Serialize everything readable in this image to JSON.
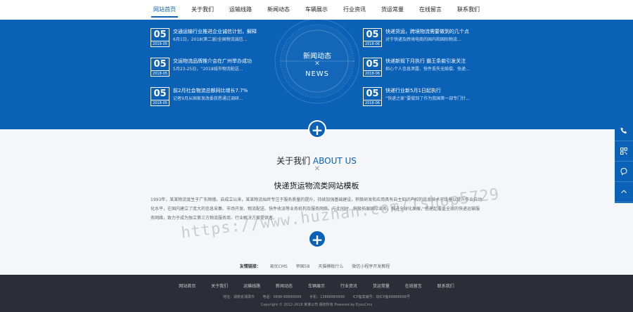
{
  "nav": {
    "items": [
      {
        "label": "网站首页",
        "active": true
      },
      {
        "label": "关于我们"
      },
      {
        "label": "运输线路"
      },
      {
        "label": "新闻动态"
      },
      {
        "label": "车辆展示"
      },
      {
        "label": "行业资讯"
      },
      {
        "label": "货运常量"
      },
      {
        "label": "在线留言"
      },
      {
        "label": "联系我们"
      }
    ]
  },
  "news": {
    "dial_title": "新闻动态",
    "dial_en": "NEWS",
    "left": [
      {
        "day": "05",
        "ym": "2018-05",
        "title": "交通运输行业推进企业诚信计划，解释",
        "desc": "6月1日，2018(第二届)全国物流诚信..."
      },
      {
        "day": "05",
        "ym": "2018-05",
        "title": "交运物流品牌推介会在广州举办成功",
        "desc": "5月23-25日，“2018城市物流配送..."
      },
      {
        "day": "05",
        "ym": "2018-05",
        "title": "前2月社会物流总额同比增长7.7%",
        "desc": "记者9月从国家发改委获悉通过调研..."
      }
    ],
    "right": [
      {
        "day": "05",
        "ym": "2018-06",
        "title": "快递货运，跨境物流需要做到的几个点",
        "desc": "对于快递及跨境电商的国内和国际物流..."
      },
      {
        "day": "05",
        "ym": "2018-06",
        "title": "快递新规下月执行 霸王条款引发关注",
        "desc": "担心个人信息泄露、快件丢失无赔偿、快递..."
      },
      {
        "day": "05",
        "ym": "2018-06",
        "title": "快递行业新5月1日起执行",
        "desc": "“快递之家”要做到了作为我国第一部专门针..."
      }
    ]
  },
  "about": {
    "title_cn": "关于我们",
    "title_en": "ABOUT US",
    "subtitle": "快递货运物流类网站模板",
    "body": "1993年，某某物流诞生于广东顺德。自成立以来，某某物流始终专注于服务质量的提升，持续加强基础建设，积极研发和应用具有自主知识产权的信息技术与设备以提升作业自动化水平，在国内建立了庞大的信息采集、市场开发、物流配送、快件收派等业务机构及服务网络。与此同时，积极拓展国际业务，推进全球化发展，搭建起覆盖全球的快递运输服务网络，致力于成为独立第三方物流服务商、行业解决方案提供者。",
    "watermark": "https://www.huzhan.com/1shop5729"
  },
  "links": {
    "label": "友情链接：",
    "items": [
      "易优CMS",
      "帝国58",
      "天猫模板什么",
      "微信小程序开发教程"
    ]
  },
  "footer": {
    "nav": [
      "网站首页",
      "关于我们",
      "运输线路",
      "新闻动态",
      "车辆展示",
      "行业资讯",
      "货运常量",
      "在线留言",
      "联系我们"
    ],
    "info": [
      "地址：湖南省湘潭市",
      "电话：0898-88889999",
      "手机：13888889999",
      "ICP备案编号：琼ICP备88888888号"
    ],
    "copyright": "Copyright © 2012-2018 某某公司 版权所有 Powered by EyouCms"
  },
  "colors": {
    "primary": "#0b61b6",
    "footer": "#2b2e36"
  },
  "side": {
    "icons": [
      "phone-icon",
      "qrcode-icon",
      "chat-icon",
      "arrow-up-icon"
    ]
  }
}
